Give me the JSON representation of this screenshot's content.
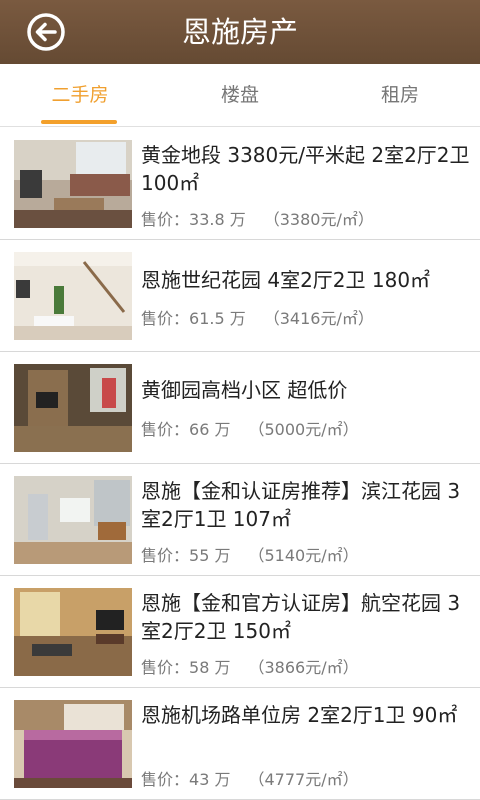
{
  "header": {
    "title": "恩施房产"
  },
  "tabs": [
    "二手房",
    "楼盘",
    "租房"
  ],
  "listings": [
    {
      "title": "黄金地段 3380元/平米起 2室2厅2卫 100㎡",
      "price_label": "售价：",
      "price": "33.8 万",
      "per": "（3380元/㎡）"
    },
    {
      "title": "恩施世纪花园 4室2厅2卫 180㎡",
      "price_label": "售价：",
      "price": "61.5 万",
      "per": "（3416元/㎡）"
    },
    {
      "title": "黄御园高档小区 超低价",
      "price_label": "售价：",
      "price": "66 万",
      "per": "（5000元/㎡）"
    },
    {
      "title": "恩施【金和认证房推荐】滨江花园 3室2厅1卫 107㎡",
      "price_label": "售价：",
      "price": "55 万",
      "per": "（5140元/㎡）"
    },
    {
      "title": "恩施【金和官方认证房】航空花园 3室2厅2卫 150㎡",
      "price_label": "售价：",
      "price": "58 万",
      "per": "（3866元/㎡）"
    },
    {
      "title": "恩施机场路单位房 2室2厅1卫 90㎡",
      "price_label": "售价：",
      "price": "43 万",
      "per": "（4777元/㎡）"
    }
  ],
  "colors": {
    "header_bg": "#6f5139",
    "accent": "#f3a02b"
  },
  "icons": {
    "back": "back-arrow-circle-icon"
  }
}
